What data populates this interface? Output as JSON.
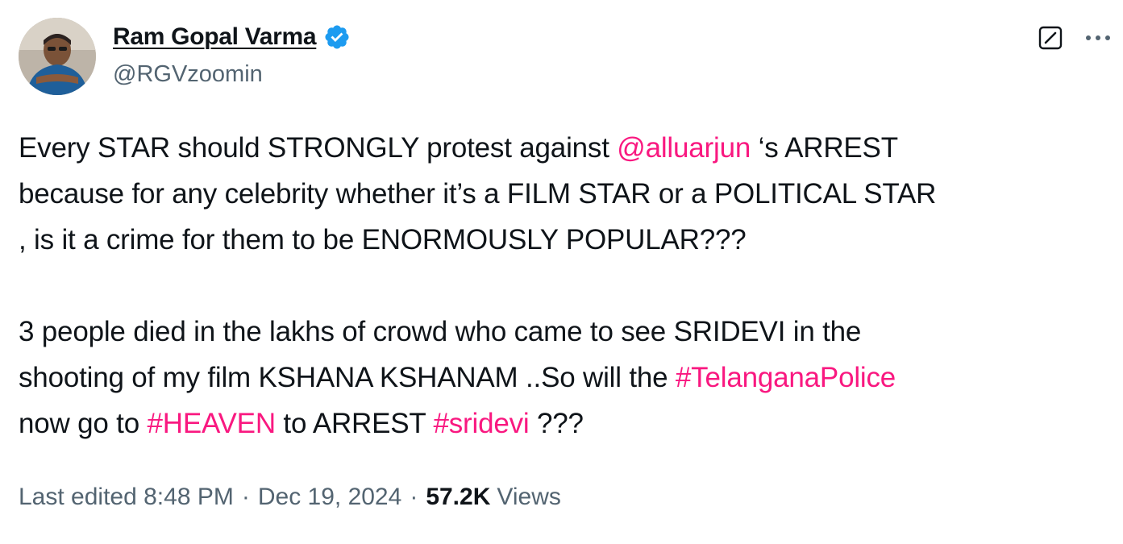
{
  "author": {
    "display_name": "Ram Gopal Varma",
    "handle": "@RGVzoomin",
    "verified": true,
    "verified_color": "#1d9bf0"
  },
  "header_icons": {
    "grok": "grok-icon",
    "more": "more-icon"
  },
  "tweet": {
    "para1": {
      "t1": "Every STAR should STRONGLY protest against ",
      "mention": "@alluarjun",
      "t2": " ‘s ARREST",
      "line2": "because for any celebrity whether it’s a FILM STAR or a POLITICAL STAR",
      "line3": ", is it a crime for them to be ENORMOUSLY POPULAR???"
    },
    "para2": {
      "line1": "3 people died in the lakhs of crowd who came to see SRIDEVI in the",
      "line2_text": "shooting of my film KSHANA KSHANAM ..So will the ",
      "hashtag1": "#TelanganaPolice",
      "line3_t1": "now go to ",
      "hashtag2": "#HEAVEN",
      "line3_t2": " to ARREST ",
      "hashtag3": "#sridevi",
      "line3_t3": " ???"
    }
  },
  "meta": {
    "edited_label": "Last edited 8:48 PM",
    "separator": "·",
    "date": "Dec 19, 2024",
    "views_count": "57.2K",
    "views_label": "Views"
  },
  "colors": {
    "link": "#f91880",
    "secondary_text": "#536471",
    "primary_text": "#0f1419"
  }
}
